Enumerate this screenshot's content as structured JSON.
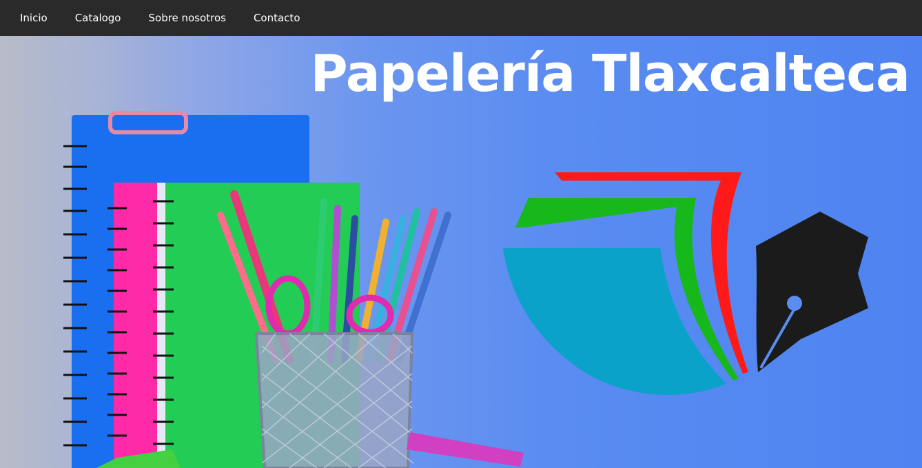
{
  "nav": {
    "items": [
      {
        "label": "Inicio"
      },
      {
        "label": "Catalogo"
      },
      {
        "label": "Sobre nosotros"
      },
      {
        "label": "Contacto"
      }
    ]
  },
  "hero": {
    "title": "Papelería Tlaxcalteca"
  },
  "colors": {
    "navbar_bg": "#2a2a2a",
    "hero_blue": "#4f84f0",
    "logo_red": "#ff1a1a",
    "logo_green": "#1fb81f",
    "logo_teal": "#0aa2c9",
    "logo_black": "#1b1b1b"
  }
}
